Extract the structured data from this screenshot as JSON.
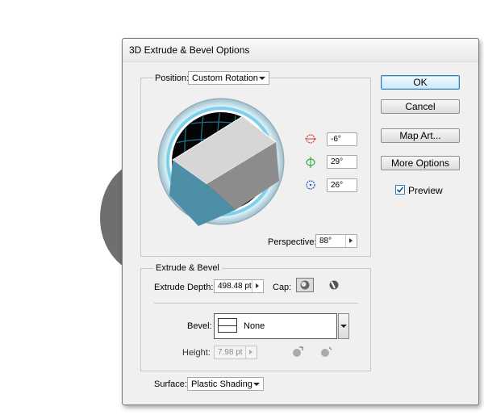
{
  "window": {
    "title": "3D Extrude & Bevel Options"
  },
  "position": {
    "label": "Position:",
    "selected": "Custom Rotation"
  },
  "rotation": {
    "x": "-6°",
    "y": "29°",
    "z": "26°"
  },
  "perspective": {
    "label": "Perspective:",
    "value": "88°"
  },
  "extrude": {
    "group_label": "Extrude & Bevel",
    "depth_label": "Extrude Depth:",
    "depth_value": "498.48 pt",
    "cap_label": "Cap:"
  },
  "bevel": {
    "label": "Bevel:",
    "selected": "None",
    "height_label": "Height:",
    "height_value": "7.98 pt"
  },
  "surface": {
    "label": "Surface:",
    "selected": "Plastic Shading"
  },
  "buttons": {
    "ok": "OK",
    "cancel": "Cancel",
    "map_art": "Map Art...",
    "more_options": "More Options"
  },
  "preview": {
    "label": "Preview",
    "checked": true
  },
  "colors": {
    "cube_front": "#4e8fa8",
    "cube_top": "#d6d6d6",
    "cube_right": "#8c8c8c",
    "ring": "#8fd3ea"
  }
}
